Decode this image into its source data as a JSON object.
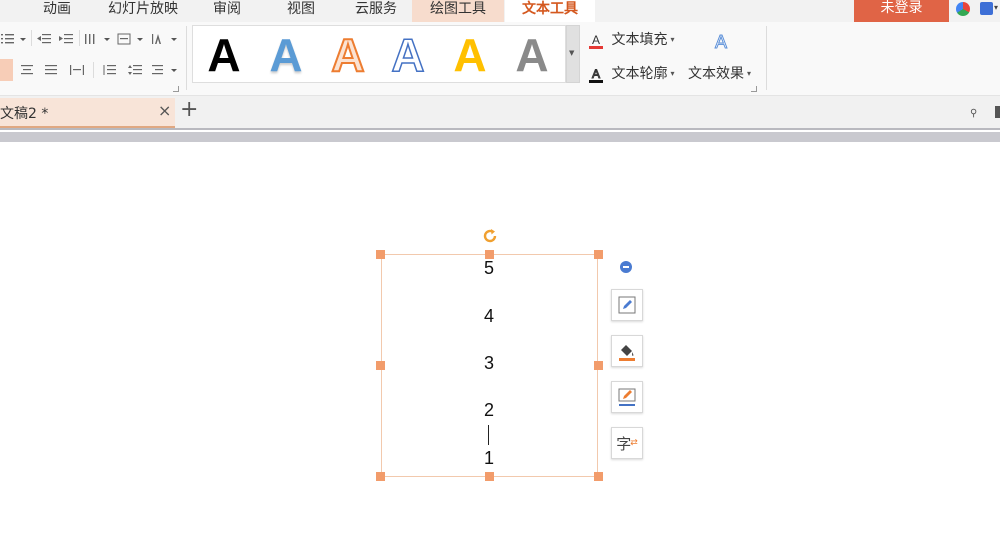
{
  "menu": {
    "tabs": [
      "动画",
      "幻灯片放映",
      "审阅",
      "视图",
      "云服务",
      "绘图工具",
      "文本工具"
    ],
    "active": "文本工具",
    "login_label": "未登录"
  },
  "ribbon": {
    "style_gallery_letter": "A",
    "style_colors": [
      "#000000",
      "#5b9bd5",
      "#ed7d31",
      "#4472c4",
      "#ffc000",
      "#808080"
    ],
    "text_fill_label": "文本填充",
    "text_outline_label": "文本轮廓",
    "text_effect_label": "文本效果",
    "effect_icon_letter": "A"
  },
  "doc_tab": {
    "title": "文稿2 *",
    "close_glyph": "×",
    "add_glyph": "+"
  },
  "textbox": {
    "lines": [
      "5",
      "4",
      "3",
      "2",
      "1"
    ]
  },
  "side_toolbar": {
    "char_glyph": "字"
  },
  "colors": {
    "accent": "#d4581f",
    "login_bg": "#e06446",
    "handle": "#f29c6b"
  }
}
